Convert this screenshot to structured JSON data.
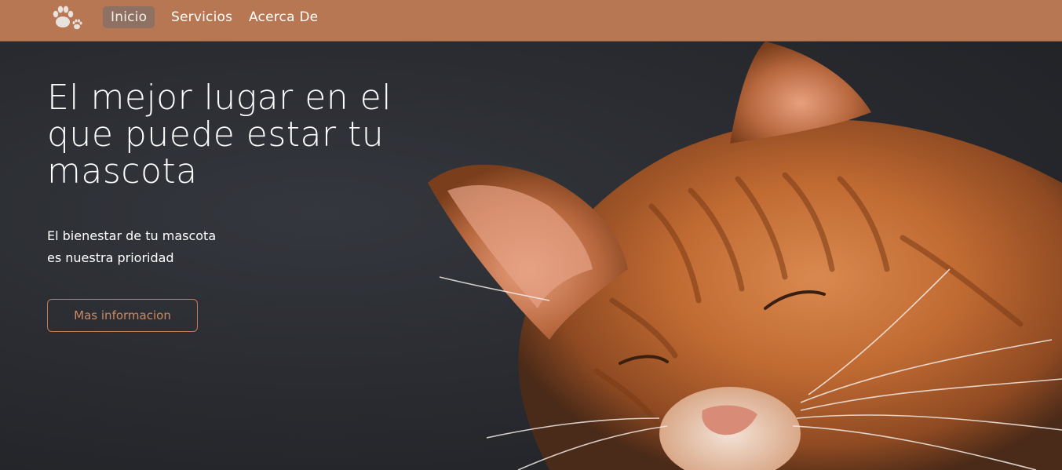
{
  "navbar": {
    "background_color": "#b87753",
    "logo_icon": "paw-icon",
    "items": [
      {
        "label": "Inicio",
        "active": true
      },
      {
        "label": "Servicios",
        "active": false
      },
      {
        "label": "Acerca De",
        "active": false
      }
    ]
  },
  "hero": {
    "title": "El mejor lugar en el que puede estar tu mascota",
    "subtitle_lines": [
      "El bienestar de tu mascota",
      "es nuestra prioridad"
    ],
    "button_label": "Mas informacion",
    "image_subject": "sleeping orange tabby cat",
    "accent_color": "#c07a54"
  }
}
